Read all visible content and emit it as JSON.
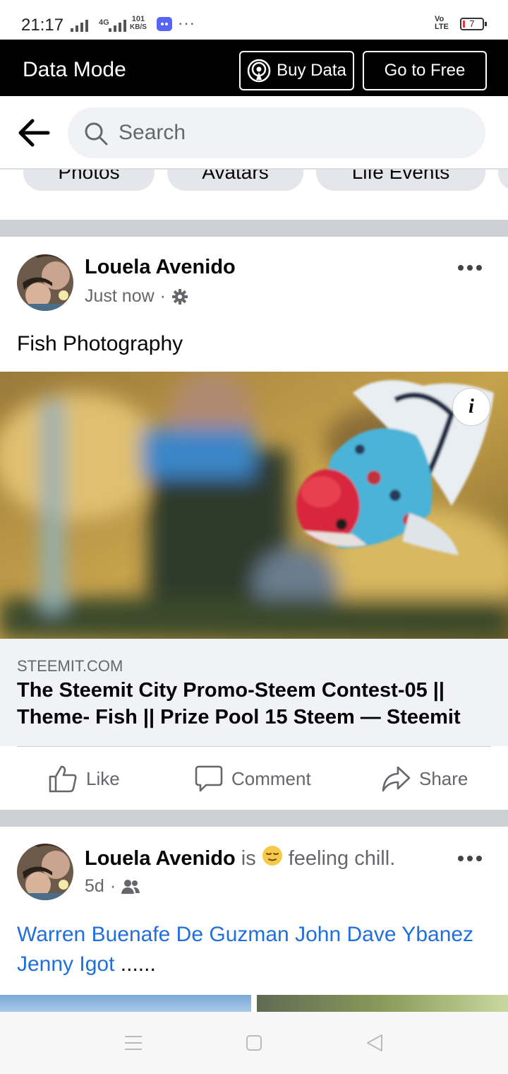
{
  "status_bar": {
    "time": "21:17",
    "network_label": "4G",
    "speed_value": "101",
    "speed_unit": "KB/S",
    "more": "···",
    "volte_line1": "Vo",
    "volte_line2": "LTE",
    "battery_level": "7"
  },
  "data_mode_bar": {
    "title": "Data Mode",
    "buy_data_label": "Buy Data",
    "go_free_label": "Go to Free"
  },
  "search": {
    "placeholder": "Search"
  },
  "chips": [
    "Photos",
    "Avatars",
    "Life Events"
  ],
  "posts": [
    {
      "author": "Louela Avenido",
      "time": "Just now",
      "privacy_icon": "gear-icon",
      "text": "Fish Photography",
      "link": {
        "domain": "STEEMIT.COM",
        "title": "The Steemit City Promo-Steem Contest-05 || Theme- Fish || Prize Pool 15 Steem — Steemit"
      },
      "actions": {
        "like": "Like",
        "comment": "Comment",
        "share": "Share"
      }
    },
    {
      "author": "Louela Avenido",
      "activity_is": "is",
      "feeling_emoji": "😌",
      "feeling_text": "feeling chill.",
      "time": "5d",
      "privacy_icon": "friends-icon",
      "mentions": [
        "Warren Buenafe De Guzman",
        "John Dave Ybanez",
        "Jenny Igot"
      ],
      "trail": "......"
    }
  ],
  "colors": {
    "accent": "#216fdb",
    "divider": "#ccd0d5",
    "data_bar": "#000000"
  }
}
